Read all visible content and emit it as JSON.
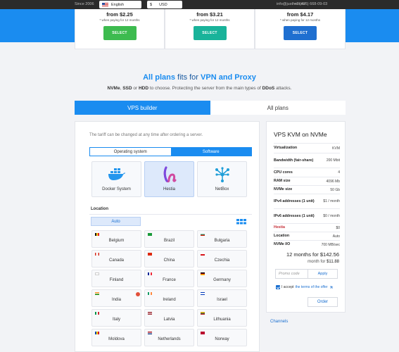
{
  "topbar": {
    "since": "Since 2006",
    "language": "English",
    "currency_symbol": "$",
    "currency": "USD",
    "email": "info@justhost.ru",
    "phone": "+7 (495) 668-09-03"
  },
  "plans": [
    {
      "price": "from $2.25",
      "note": "* when paying for 12 months",
      "button": "SELECT",
      "color": "#3dbb4f"
    },
    {
      "price": "from $3.21",
      "note": "* when paying for 12 months",
      "button": "SELECT",
      "color": "#19b39a"
    },
    {
      "price": "from $4.17",
      "note": "* when paying for 12 months",
      "button": "SELECT",
      "color": "#1f6fd0"
    }
  ],
  "heading": {
    "part1": "All plans ",
    "part2": "fits for",
    "part3": " VPN and Proxy"
  },
  "subtitle": {
    "nvme": "NVMe",
    "sep1": ", ",
    "ssd": "SSD",
    "sep2": " or ",
    "hdd": "HDD",
    "mid": " to choose. Protecting the server from the main types of ",
    "ddos": "DDoS",
    "end": " attacks."
  },
  "tabs": {
    "builder": "VPS builder",
    "all": "All plans"
  },
  "builder": {
    "hint": "The tariff can be changed at any time after ordering a server.",
    "segment_os": "Operating system",
    "segment_software": "Software",
    "software": [
      {
        "label": "Docker System",
        "icon": "docker-icon"
      },
      {
        "label": "Hestia",
        "icon": "hestia-icon"
      },
      {
        "label": "NetBox",
        "icon": "netbox-icon"
      }
    ],
    "location_label": "Location",
    "auto": "Auto",
    "countries": [
      {
        "name": "Belgium",
        "flag": "be"
      },
      {
        "name": "Brazil",
        "flag": "br"
      },
      {
        "name": "Bulgaria",
        "flag": "bg"
      },
      {
        "name": "Canada",
        "flag": "ca"
      },
      {
        "name": "China",
        "flag": "cn"
      },
      {
        "name": "Czechia",
        "flag": "cz"
      },
      {
        "name": "Finland",
        "flag": "fi"
      },
      {
        "name": "France",
        "flag": "fr"
      },
      {
        "name": "Germany",
        "flag": "de"
      },
      {
        "name": "India",
        "flag": "in"
      },
      {
        "name": "Ireland",
        "flag": "ie"
      },
      {
        "name": "Israel",
        "flag": "il"
      },
      {
        "name": "Italy",
        "flag": "it"
      },
      {
        "name": "Latvia",
        "flag": "lv"
      },
      {
        "name": "Lithuania",
        "flag": "lt"
      },
      {
        "name": "Moldova",
        "flag": "md"
      },
      {
        "name": "Netherlands",
        "flag": "nl"
      },
      {
        "name": "Norway",
        "flag": "no"
      }
    ]
  },
  "summary": {
    "title": "VPS KVM on NVMe",
    "rows": [
      {
        "k": "Virtualization",
        "v": "KVM"
      },
      {
        "k": "Bandwidth (fair-share)",
        "v": "200 Mbit"
      },
      {
        "k": "CPU cores",
        "v": "4"
      },
      {
        "k": "RAM size",
        "v": "4096 Mb"
      },
      {
        "k": "NVMe size",
        "v": "50 Gb"
      },
      {
        "k": "IPv4 addresses (1 unit)",
        "v": "$1 / month"
      },
      {
        "k": "IPv6 addresses (1 unit)",
        "v": "$0 / month"
      },
      {
        "k": "Hestia",
        "v": "$0"
      },
      {
        "k": "Location",
        "v": "Auto"
      },
      {
        "k": "NVMe I/O",
        "v": "700 MB/sec"
      }
    ],
    "total": "12 months for $142.56",
    "monthly_prefix": "month for ",
    "monthly_value": "$11.88",
    "promo_placeholder": "Promo code",
    "apply": "Apply",
    "accept_prefix": "I accept ",
    "accept_link": "the terms of the offer",
    "order": "Order"
  },
  "channels": "Channels",
  "colors": {
    "accent": "#1a8cf0",
    "brand_dark": "#1a5aa0",
    "danger": "#c6323a"
  }
}
